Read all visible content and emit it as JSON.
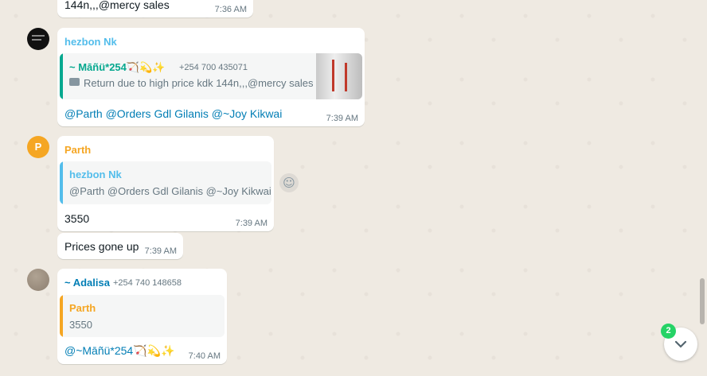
{
  "messages": [
    {
      "text": "144n,,,@mercy sales",
      "time": "7:36 AM"
    },
    {
      "sender": "hezbon Nk",
      "quote": {
        "author": "~ Māñü*254🏹💫✨",
        "phone": "+254 700 435071",
        "text": "Return due to high price kdk 144n,,,@mercy sales"
      },
      "body": "@Parth @Orders Gdl Gilanis @~Joy Kikwai",
      "time": "7:39 AM"
    },
    {
      "sender": "Parth",
      "avatar_letter": "P",
      "quote": {
        "author": "hezbon Nk",
        "text": "@Parth @Orders Gdl Gilanis @~Joy Kikwai"
      },
      "body": "3550",
      "time": "7:39 AM"
    },
    {
      "text": "Prices gone up",
      "time": "7:39 AM"
    },
    {
      "sender": "~ Adalisa",
      "phone": "+254 740 148658",
      "quote": {
        "author": "Parth",
        "text": "3550"
      },
      "body": "@~Māñü*254🏹💫✨",
      "time": "7:40 AM"
    }
  ],
  "scroll_badge": "2",
  "colors": {
    "hezbon": "#53bdeb",
    "parth": "#f5a623",
    "adalisa": "#027eb5",
    "manu": "#06a88f",
    "badge": "#25d366"
  }
}
